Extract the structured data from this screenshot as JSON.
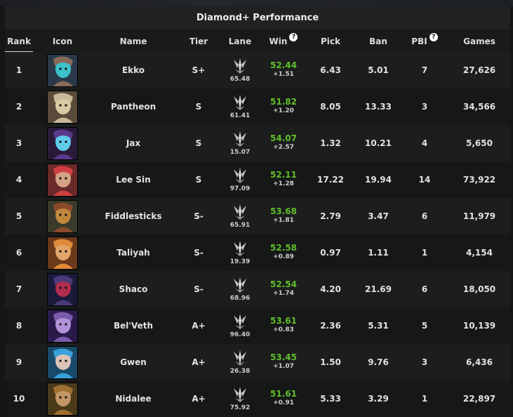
{
  "title": "Diamond+ Performance",
  "headers": {
    "rank": "Rank",
    "icon": "Icon",
    "name": "Name",
    "tier": "Tier",
    "lane": "Lane",
    "win": "Win",
    "pick": "Pick",
    "ban": "Ban",
    "pbi": "PBI",
    "games": "Games",
    "help": "?"
  },
  "colors": {
    "win_positive": "#5fbf2a",
    "lane_icon": "#c8c8c8"
  },
  "rows": [
    {
      "rank": "1",
      "name": "Ekko",
      "tier": "S+",
      "lane": "65.48",
      "win": "52.44",
      "win_delta": "+1.51",
      "pick": "6.43",
      "ban": "5.01",
      "pbi": "7",
      "games": "27,626",
      "icon": "ekko-icon"
    },
    {
      "rank": "2",
      "name": "Pantheon",
      "tier": "S",
      "lane": "61.41",
      "win": "51.82",
      "win_delta": "+1.20",
      "pick": "8.05",
      "ban": "13.33",
      "pbi": "3",
      "games": "34,566",
      "icon": "pantheon-icon"
    },
    {
      "rank": "3",
      "name": "Jax",
      "tier": "S",
      "lane": "15.07",
      "win": "54.07",
      "win_delta": "+2.57",
      "pick": "1.32",
      "ban": "10.21",
      "pbi": "4",
      "games": "5,650",
      "icon": "jax-icon"
    },
    {
      "rank": "4",
      "name": "Lee Sin",
      "tier": "S",
      "lane": "97.09",
      "win": "52.11",
      "win_delta": "+1.28",
      "pick": "17.22",
      "ban": "19.94",
      "pbi": "14",
      "games": "73,922",
      "icon": "lee-sin-icon"
    },
    {
      "rank": "5",
      "name": "Fiddlesticks",
      "tier": "S-",
      "lane": "65.91",
      "win": "53.68",
      "win_delta": "+1.81",
      "pick": "2.79",
      "ban": "3.47",
      "pbi": "6",
      "games": "11,979",
      "icon": "fiddlesticks-icon"
    },
    {
      "rank": "6",
      "name": "Taliyah",
      "tier": "S-",
      "lane": "19.39",
      "win": "52.58",
      "win_delta": "+0.89",
      "pick": "0.97",
      "ban": "1.11",
      "pbi": "1",
      "games": "4,154",
      "icon": "taliyah-icon"
    },
    {
      "rank": "7",
      "name": "Shaco",
      "tier": "S-",
      "lane": "68.96",
      "win": "52.54",
      "win_delta": "+1.74",
      "pick": "4.20",
      "ban": "21.69",
      "pbi": "6",
      "games": "18,050",
      "icon": "shaco-icon"
    },
    {
      "rank": "8",
      "name": "Bel'Veth",
      "tier": "A+",
      "lane": "96.40",
      "win": "53.61",
      "win_delta": "+0.83",
      "pick": "2.36",
      "ban": "5.31",
      "pbi": "5",
      "games": "10,139",
      "icon": "belveth-icon"
    },
    {
      "rank": "9",
      "name": "Gwen",
      "tier": "A+",
      "lane": "26.38",
      "win": "53.45",
      "win_delta": "+1.07",
      "pick": "1.50",
      "ban": "9.76",
      "pbi": "3",
      "games": "6,436",
      "icon": "gwen-icon"
    },
    {
      "rank": "10",
      "name": "Nidalee",
      "tier": "A+",
      "lane": "75.92",
      "win": "51.61",
      "win_delta": "+0.91",
      "pick": "5.33",
      "ban": "3.29",
      "pbi": "1",
      "games": "22,897",
      "icon": "nidalee-icon"
    }
  ]
}
